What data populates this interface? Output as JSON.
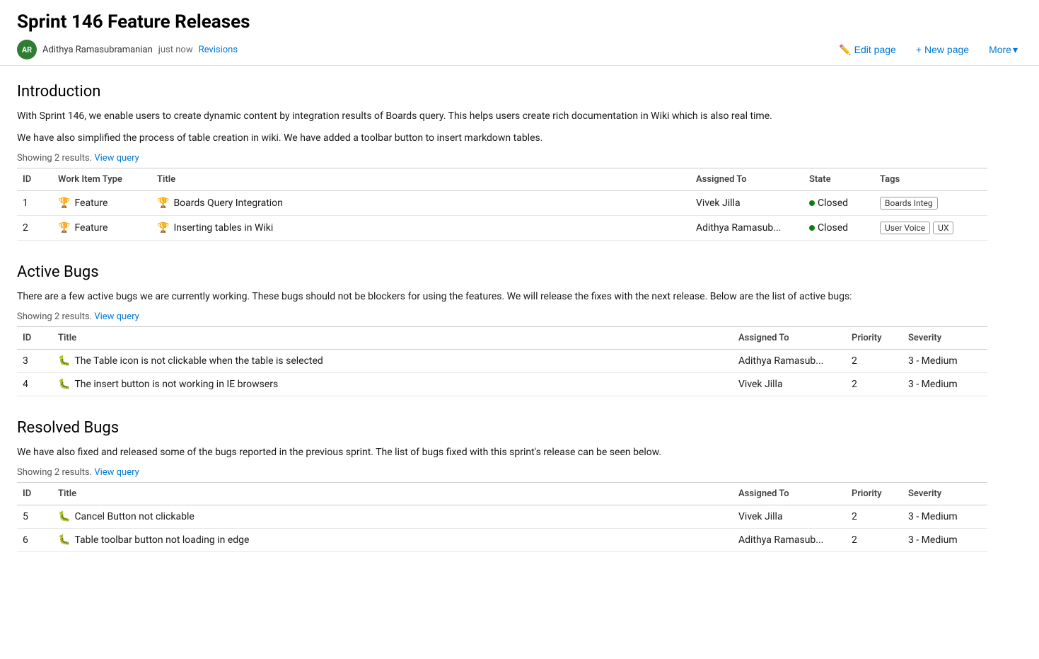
{
  "header": {
    "title": "Sprint 146 Feature Releases",
    "avatar_initials": "AR",
    "author": "Adithya Ramasubramanian",
    "timestamp": "just now",
    "revisions_label": "Revisions",
    "edit_page_label": "Edit page",
    "new_page_label": "New page",
    "more_label": "More"
  },
  "introduction": {
    "section_title": "Introduction",
    "paragraphs": [
      "With Sprint 146, we enable users to create dynamic content by integration results of Boards query. This helps users create rich documentation in Wiki which is also real time.",
      "We have also simplified the process of table creation in wiki. We have added a toolbar button to insert markdown tables."
    ],
    "showing_results": "Showing 2 results.",
    "view_query_label": "View query",
    "table": {
      "columns": [
        "ID",
        "Work Item Type",
        "Title",
        "Assigned To",
        "State",
        "Tags"
      ],
      "rows": [
        {
          "id": "1",
          "work_item_type": "Feature",
          "title": "Boards Query Integration",
          "assigned_to": "Vivek Jilla",
          "state": "Closed",
          "tags": [
            "Boards Integ"
          ]
        },
        {
          "id": "2",
          "work_item_type": "Feature",
          "title": "Inserting tables in Wiki",
          "assigned_to": "Adithya Ramasub...",
          "state": "Closed",
          "tags": [
            "User Voice",
            "UX"
          ]
        }
      ]
    }
  },
  "active_bugs": {
    "section_title": "Active Bugs",
    "description": "There are a few active bugs we are currently working. These bugs should not be blockers for using the features. We will release the fixes with the next release. Below are the list of active bugs:",
    "showing_results": "Showing 2 results.",
    "view_query_label": "View query",
    "table": {
      "columns": [
        "ID",
        "Title",
        "Assigned To",
        "Priority",
        "Severity"
      ],
      "rows": [
        {
          "id": "3",
          "title": "The Table icon is not clickable when the table is selected",
          "assigned_to": "Adithya Ramasub...",
          "priority": "2",
          "severity": "3 - Medium"
        },
        {
          "id": "4",
          "title": "The insert button is not working in IE browsers",
          "assigned_to": "Vivek Jilla",
          "priority": "2",
          "severity": "3 - Medium"
        }
      ]
    }
  },
  "resolved_bugs": {
    "section_title": "Resolved Bugs",
    "description": "We have also fixed and released some of the bugs reported in the previous sprint. The list of bugs fixed with this sprint's release can be seen below.",
    "showing_results": "Showing 2 results.",
    "view_query_label": "View query",
    "table": {
      "columns": [
        "ID",
        "Title",
        "Assigned To",
        "Priority",
        "Severity"
      ],
      "rows": [
        {
          "id": "5",
          "title": "Cancel Button not clickable",
          "assigned_to": "Vivek Jilla",
          "priority": "2",
          "severity": "3 - Medium"
        },
        {
          "id": "6",
          "title": "Table toolbar button not loading in edge",
          "assigned_to": "Adithya Ramasub...",
          "priority": "2",
          "severity": "3 - Medium"
        }
      ]
    }
  }
}
